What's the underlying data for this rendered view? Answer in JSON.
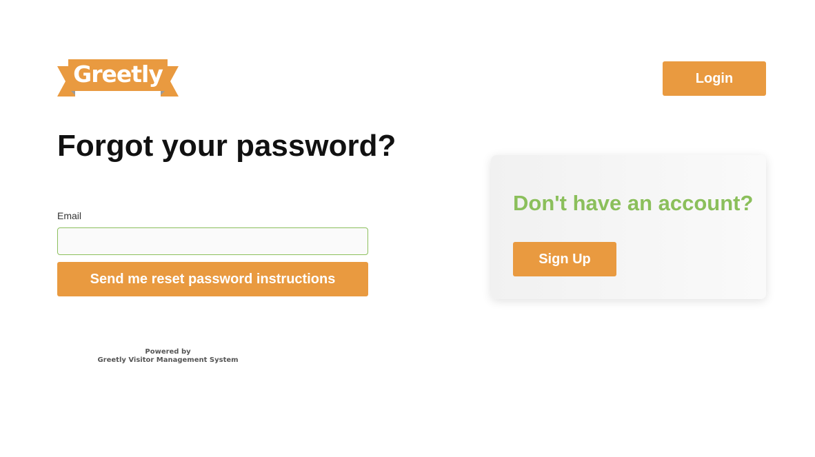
{
  "header": {
    "logo_text": "Greetly",
    "login_label": "Login"
  },
  "main": {
    "title": "Forgot your password?",
    "email_label": "Email",
    "email_value": "",
    "reset_button_label": "Send me reset password instructions"
  },
  "footer": {
    "powered_by": "Powered by",
    "system_name": "Greetly Visitor Management System"
  },
  "signup": {
    "heading": "Don't have an account?",
    "button_label": "Sign Up"
  },
  "colors": {
    "accent_orange": "#e99a40",
    "accent_green": "#8bbf5b",
    "ribbon_shadow": "#9a9a9a"
  }
}
